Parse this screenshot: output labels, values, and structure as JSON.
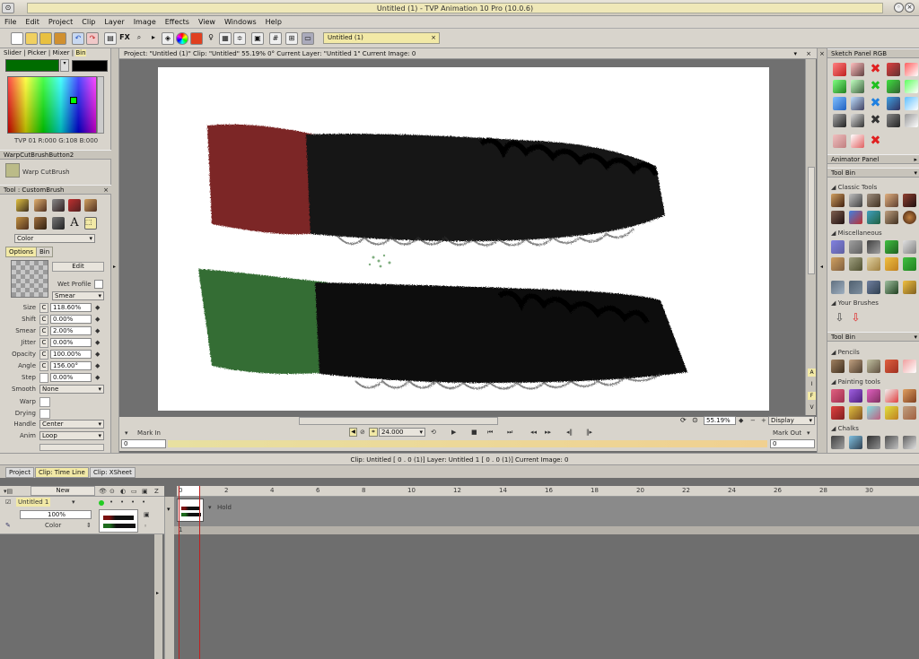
{
  "window": {
    "title": "Untitled (1) - TVP Animation 10 Pro (10.0.6)"
  },
  "menu": [
    "File",
    "Edit",
    "Project",
    "Clip",
    "Layer",
    "Image",
    "Effects",
    "View",
    "Windows",
    "Help"
  ],
  "toolbar": {
    "fx_label": "FX",
    "document_tab": "Untitled (1)"
  },
  "left": {
    "picker_tabs": [
      "Slider",
      "Picker",
      "Mixer",
      "Bin"
    ],
    "color_readout": "TVP 01 R:000 G:108 B:000",
    "brush_panel_title": "WarpCutBrushButton2",
    "brush_name": "Warp CutBrush",
    "tool_panel_title": "Tool : CustomBrush",
    "color_mode": "Color",
    "options_tabs": [
      "Options",
      "Bin"
    ],
    "edit_label": "Edit",
    "wet_profile": "Wet Profile",
    "smear_mode": "Smear",
    "params": [
      {
        "label": "Size",
        "value": "118.60%"
      },
      {
        "label": "Shift",
        "value": "0.00%"
      },
      {
        "label": "Smear",
        "value": "2.00%"
      },
      {
        "label": "Jitter",
        "value": "0.00%"
      },
      {
        "label": "Opacity",
        "value": "100.00%"
      },
      {
        "label": "Angle",
        "value": "156.00°"
      },
      {
        "label": "Step",
        "value": "0.00%"
      }
    ],
    "smooth_label": "Smooth",
    "smooth_value": "None",
    "warp_label": "Warp",
    "drying_label": "Drying",
    "handle_label": "Handle",
    "handle_value": "Center",
    "anim_label": "Anim",
    "anim_value": "Loop"
  },
  "viewport": {
    "project_info": "Project: \"Untitled (1)\" Clip: \"Untitled\"   55.19%   0°   Current Layer: \"Untitled 1\"  Current Image: 0",
    "zoom": "55.19%",
    "display_label": "Display",
    "mark_in_label": "Mark In",
    "mark_in_value": "0",
    "mark_out_label": "Mark Out",
    "mark_out_value": "0",
    "fps": "24.000",
    "side_letters": [
      "A",
      "I",
      "F",
      "V"
    ]
  },
  "status": {
    "text": "Clip: Untitled [ 0 . 0  (1)]       Layer: Untitled 1 [ 0 . 0  (1)]    Current Image: 0"
  },
  "right": {
    "sketch_panel": "Sketch Panel RGB",
    "animator_panel": "Animator Panel",
    "tool_bin": "Tool Bin",
    "classic_tools": "Classic Tools",
    "miscellaneous": "Miscellaneous",
    "your_brushes": "Your Brushes",
    "tool_bin2": "Tool Bin",
    "pencils": "Pencils",
    "painting_tools": "Painting tools",
    "chalks": "Chalks"
  },
  "timeline": {
    "tabs": [
      "Project",
      "Clip: Time Line",
      "Clip: XSheet"
    ],
    "new_label": "New",
    "layer_name": "Untitled 1",
    "opacity": "100%",
    "blend": "Color",
    "hold_label": "Hold",
    "frame_number": "1",
    "ruler": [
      "0",
      "2",
      "4",
      "6",
      "8",
      "10",
      "12",
      "14",
      "16",
      "18",
      "20",
      "22",
      "24",
      "26",
      "28",
      "30"
    ]
  },
  "colors": {
    "primary": "#006c00",
    "secondary": "#000000",
    "canvas": "#ffffff",
    "stroke_red": "#7a1010",
    "stroke_green": "#1d6b1d"
  }
}
